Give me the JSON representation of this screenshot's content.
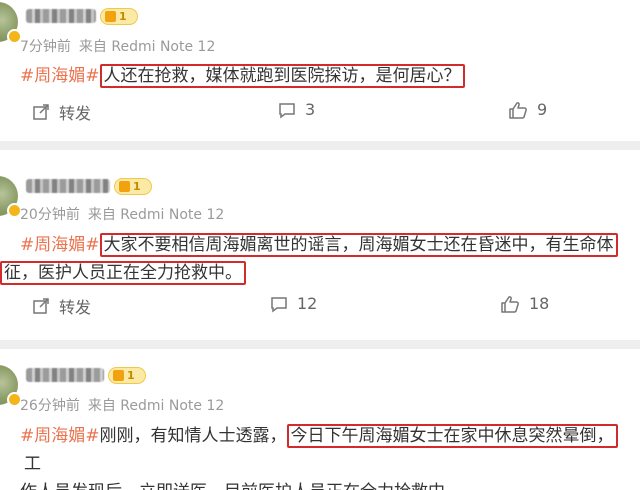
{
  "posts": [
    {
      "badge": "1",
      "time": "7分钟前",
      "source": "来自 Redmi Note 12",
      "tag": "#周海媚#",
      "highlighted_text": "人还在抢救，媒体就跑到医院探访，是何居心？",
      "text_after": "",
      "repost_label": "转发",
      "comments": "3",
      "likes": "9"
    },
    {
      "badge": "1",
      "time": "20分钟前",
      "source": "来自 Redmi Note 12",
      "tag": "#周海媚#",
      "text_before": "",
      "highlighted_line1": "大家不要相信周海媚离世的谣言，周海媚女士还在昏迷中，有生命体",
      "highlighted_line2": "征，医护人员正在全力抢救中。",
      "repost_label": "转发",
      "comments": "12",
      "likes": "18"
    },
    {
      "badge": "1",
      "time": "26分钟前",
      "source": "来自 Redmi Note 12",
      "tag": "#周海媚#",
      "text_before": "刚刚，有知情人士透露，",
      "highlighted_text": "今日下午周海媚女士在家中休息突然晕倒，",
      "text_after": "工",
      "line2": "作人员发现后，立即送医，目前医护人员正在全力抢救中。"
    }
  ],
  "colors": {
    "tag": "#eb7350",
    "highlight_border": "#d22b2b",
    "meta": "#9a9a9a",
    "separator": "#eeeeee"
  },
  "icons": [
    "repost-icon",
    "comment-icon",
    "like-icon"
  ]
}
